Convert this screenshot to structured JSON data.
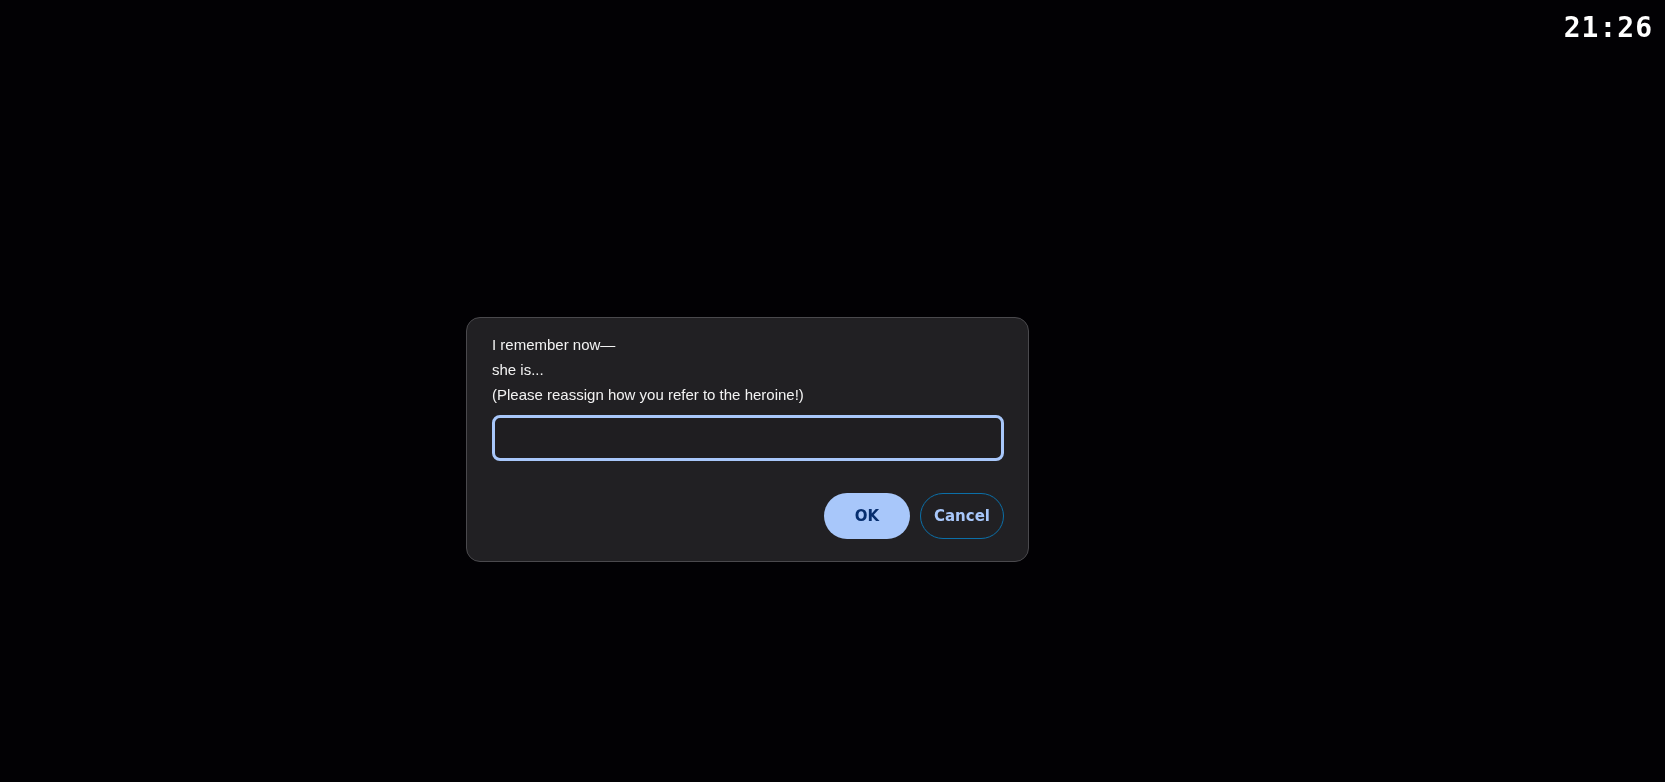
{
  "clock": "21:26",
  "dialog": {
    "message_lines": [
      "I remember now—",
      "she is...",
      "(Please reassign how you refer to the heroine!)"
    ],
    "input": {
      "focused": true
    },
    "buttons": [
      {
        "label": "OK",
        "kind": "primary"
      },
      {
        "label": "Cancel",
        "kind": "secondary"
      }
    ]
  }
}
